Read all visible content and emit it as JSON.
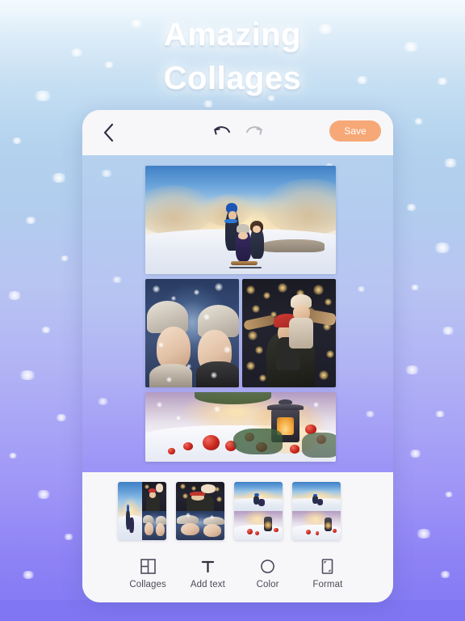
{
  "app": {
    "headline_line1": "Amazing",
    "headline_line2": "Collages"
  },
  "theme": {
    "background_top": "#f4fbfe",
    "background_bottom": "#8278f2",
    "card_background": "#f7f7f9",
    "save_button_color": "#f7a877",
    "save_button_text_color": "#ffffff",
    "icon_color": "#35364a",
    "disabled_icon_color": "#b8b8c2",
    "label_color": "#4b4b57"
  },
  "toolbar": {
    "back_icon": "chevron-left-icon",
    "back_label": "Back",
    "undo_icon": "undo-arrow-icon",
    "undo_label": "Undo",
    "undo_enabled": "true",
    "redo_icon": "redo-arrow-icon",
    "redo_label": "Redo",
    "redo_enabled": "false",
    "save_label": "Save"
  },
  "canvas": {
    "layout_name": "3-row collage",
    "cells": [
      {
        "id": "cell-top",
        "scene": "family-sledding-in-snow-at-sunset",
        "alt": "Father pushing two children on a sled through snow with golden sunset light"
      },
      {
        "id": "cell-mid-left",
        "scene": "two-women-in-knit-hats-facing-each-other",
        "alt": "Two smiling women in white knit hats face to face while snow falls"
      },
      {
        "id": "cell-mid-right",
        "scene": "man-with-child-on-shoulders-bokeh-lights",
        "alt": "Bearded man in red hat carrying a child on his shoulders under string lights"
      },
      {
        "id": "cell-bottom",
        "scene": "christmas-lantern-with-red-ornaments-on-snow",
        "alt": "Christmas lantern glowing beside red baubles and berries on snow"
      }
    ]
  },
  "thumbnails": {
    "selected_index": 0,
    "items": [
      {
        "id": "thumb-1",
        "layout": "one-left-two-right",
        "label": "Layout 1"
      },
      {
        "id": "thumb-2",
        "layout": "two-stacked",
        "label": "Layout 2"
      },
      {
        "id": "thumb-3",
        "layout": "two-stacked-alt",
        "label": "Layout 3"
      },
      {
        "id": "thumb-4",
        "layout": "two-stacked-wide",
        "label": "Layout 4"
      }
    ]
  },
  "tabbar": {
    "items": [
      {
        "label": "Collages",
        "icon": "grid-layout-icon",
        "active": "true"
      },
      {
        "label": "Add text",
        "icon": "text-t-icon",
        "active": "false"
      },
      {
        "label": "Color",
        "icon": "circle-outline-icon",
        "active": "false"
      },
      {
        "label": "Format",
        "icon": "crop-format-icon",
        "active": "false"
      }
    ]
  }
}
